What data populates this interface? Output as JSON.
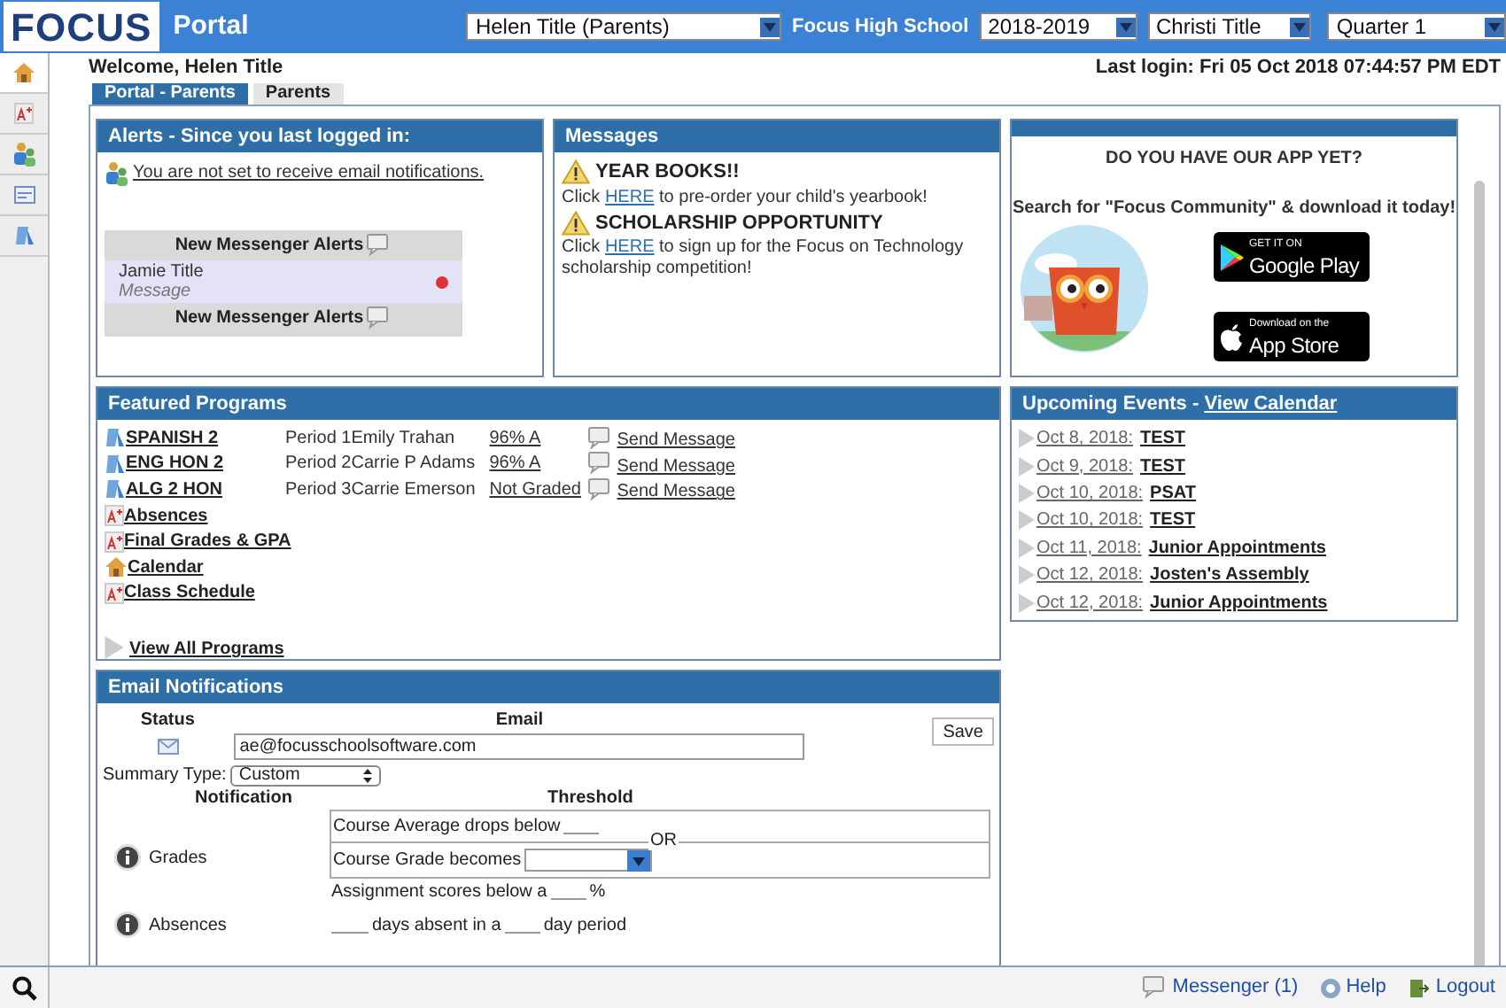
{
  "header": {
    "logo": "FOCUS",
    "title": "Portal",
    "user_select": "Helen Title (Parents)",
    "school": "Focus High School",
    "year_select": "2018-2019",
    "student_select": "Christi Title",
    "term_select": "Quarter 1"
  },
  "sidebar": {
    "items": [
      {
        "selected": true
      },
      {
        "selected": false
      },
      {
        "selected": false
      },
      {
        "selected": false
      },
      {
        "selected": false
      }
    ]
  },
  "welcome": "Welcome, Helen Title",
  "last_login": "Last login: Fri 05 Oct 2018 07:44:57 PM EDT",
  "tabs": [
    {
      "label": "Portal - Parents",
      "selected": true
    },
    {
      "label": "Parents",
      "selected": false
    }
  ],
  "alerts": {
    "title": "Alerts - Since you last logged in:",
    "notice": "You are not set to receive email notifications.",
    "messenger_header": "New Messenger Alerts",
    "messages": [
      {
        "sender": "Jamie Title",
        "preview": "Message",
        "unread": true
      }
    ],
    "messenger_footer": "New Messenger Alerts"
  },
  "messages": {
    "title": "Messages",
    "items": [
      {
        "heading": "YEAR BOOKS!!",
        "before": "Click ",
        "link": "HERE",
        "after": " to pre-order your child's yearbook!"
      },
      {
        "heading": "SCHOLARSHIP OPPORTUNITY",
        "before": "Click ",
        "link": "HERE",
        "after": " to sign up for the Focus on Technology scholarship competition!"
      }
    ]
  },
  "app_promo": {
    "heading": "DO YOU HAVE OUR APP YET?",
    "text": "Search for \"Focus Community\" & download it today!",
    "google_play": {
      "small": "GET IT ON",
      "large": "Google Play"
    },
    "app_store": {
      "small": "Download on the",
      "large": "App Store"
    }
  },
  "featured_programs": {
    "title": "Featured Programs",
    "items": [
      {
        "kind": "course",
        "label": "SPANISH 2",
        "period": "Period 1",
        "teacher": "Emily Trahan",
        "grade": "96% A",
        "action": "Send Message"
      },
      {
        "kind": "course",
        "label": "ENG HON 2",
        "period": "Period 2",
        "teacher": "Carrie P Adams",
        "grade": "96% A",
        "action": "Send Message"
      },
      {
        "kind": "course",
        "label": "ALG 2 HON",
        "period": "Period 3",
        "teacher": "Carrie Emerson",
        "grade": "Not Graded",
        "action": "Send Message"
      },
      {
        "kind": "report",
        "label": "Absences"
      },
      {
        "kind": "report",
        "label": "Final Grades & GPA"
      },
      {
        "kind": "calendar",
        "label": "Calendar"
      },
      {
        "kind": "report",
        "label": "Class Schedule"
      }
    ],
    "view_all": "View All Programs"
  },
  "upcoming_events": {
    "title": "Upcoming Events - ",
    "link": "View Calendar",
    "events": [
      {
        "date": "Oct 8, 2018:",
        "name": "TEST"
      },
      {
        "date": "Oct 9, 2018:",
        "name": "TEST"
      },
      {
        "date": "Oct 10, 2018:",
        "name": "PSAT"
      },
      {
        "date": "Oct 10, 2018:",
        "name": "TEST"
      },
      {
        "date": "Oct 11, 2018:",
        "name": "Junior Appointments"
      },
      {
        "date": "Oct 12, 2018:",
        "name": "Josten's Assembly"
      },
      {
        "date": "Oct 12, 2018:",
        "name": "Junior Appointments"
      }
    ]
  },
  "email_notifications": {
    "title": "Email Notifications",
    "status_label": "Status",
    "email_label": "Email",
    "email": "ae@focusschoolsoftware.com",
    "save": "Save",
    "summary_label": "Summary Type:",
    "summary_type": "Custom",
    "notification_header": "Notification",
    "threshold_header": "Threshold",
    "grades": {
      "label": "Grades",
      "average_text": "Course Average drops below",
      "or": "OR",
      "grade_text": "Course Grade becomes",
      "assignment_text": "Assignment scores below a",
      "percent": "%"
    },
    "absences": {
      "label": "Absences",
      "days_text": "days absent in a",
      "period_text": "day period"
    }
  },
  "footer": {
    "messenger": "Messenger (1)",
    "help": "Help",
    "logout": "Logout"
  }
}
